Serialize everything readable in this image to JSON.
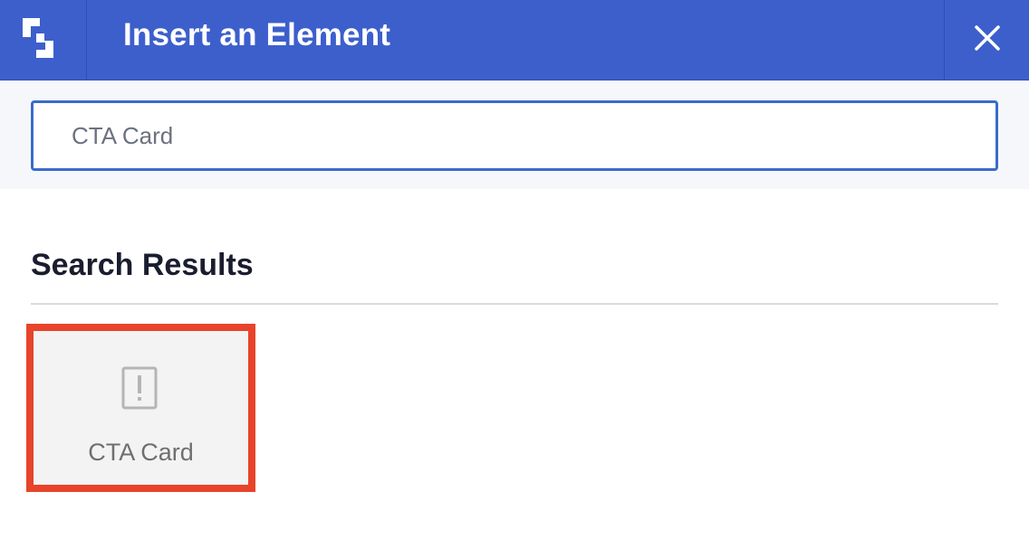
{
  "header": {
    "logo_icon": "brand-logo-icon",
    "title": "Insert an Element",
    "close_icon": "close-icon",
    "background_color": "#3d5fcc"
  },
  "search": {
    "value": "CTA Card",
    "border_color": "#3a6cc9"
  },
  "results": {
    "heading": "Search Results",
    "items": [
      {
        "label": "CTA Card",
        "icon": "alert-box-icon",
        "selected": true,
        "highlight_color": "#e8432b"
      }
    ]
  }
}
